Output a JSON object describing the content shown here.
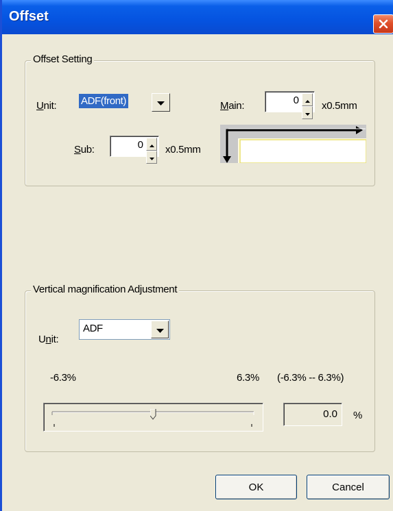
{
  "dialog": {
    "title": "Offset"
  },
  "offset_setting": {
    "group_title": "Offset Setting",
    "unit_label": "Unit:",
    "unit_value": "ADF(front)",
    "main_label": "Main:",
    "main_value": "0",
    "main_unit": "x0.5mm",
    "sub_label": "Sub:",
    "sub_value": "0",
    "sub_unit": "x0.5mm"
  },
  "vertical_magnification": {
    "group_title": "Vertical magnification Adjustment",
    "unit_label": "Unit:",
    "unit_value": "ADF",
    "min_label": "-6.3%",
    "max_label": "6.3%",
    "range_label": "(-6.3% -- 6.3%)",
    "slider_position": 0.5,
    "value": "0.0",
    "percent_sign": "%"
  },
  "buttons": {
    "ok": "OK",
    "cancel": "Cancel"
  },
  "icons": {
    "close": "close-icon",
    "dropdown": "chevron-down-icon",
    "spin_up": "arrow-up-icon",
    "spin_down": "arrow-down-icon"
  },
  "colors": {
    "titlebar": "#0553e0",
    "close_button": "#e0502a",
    "selection": "#316ac5",
    "window_background": "#ece9d8"
  }
}
